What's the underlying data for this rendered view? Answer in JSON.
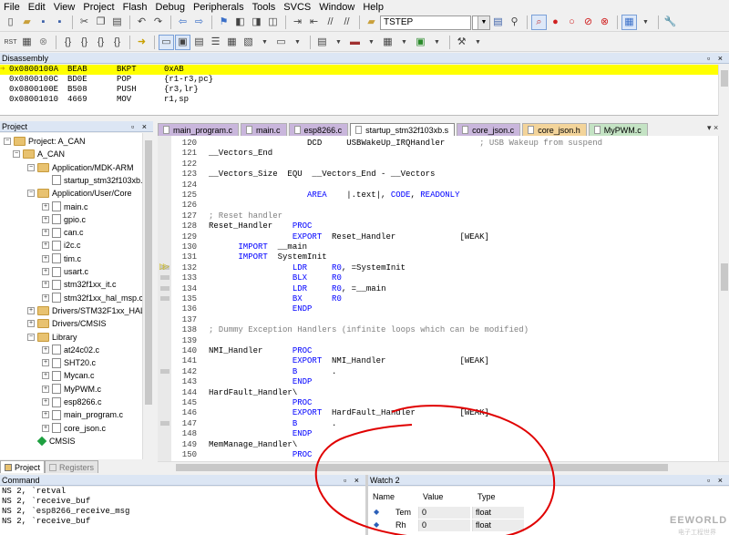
{
  "menu": [
    "File",
    "Edit",
    "View",
    "Project",
    "Flash",
    "Debug",
    "Peripherals",
    "Tools",
    "SVCS",
    "Window",
    "Help"
  ],
  "toolbar": {
    "find_text": "TSTEP"
  },
  "panels": {
    "disassembly": "Disassembly",
    "project": "Project",
    "command": "Command",
    "watch": "Watch 2"
  },
  "disassembly": [
    {
      "addr": "0x0800100A",
      "hex": "BEAB",
      "mnem": "BKPT",
      "ops": "0xAB"
    },
    {
      "addr": "0x0800100C",
      "hex": "BD0E",
      "mnem": "POP",
      "ops": "{r1-r3,pc}"
    },
    {
      "addr": "0x0800100E",
      "hex": "B508",
      "mnem": "PUSH",
      "ops": "{r3,lr}"
    },
    {
      "addr": "0x08001010",
      "hex": "4669",
      "mnem": "MOV",
      "ops": "r1,sp"
    }
  ],
  "tree": [
    {
      "label": "Project: A_CAN",
      "pm": "−"
    },
    {
      "label": "A_CAN",
      "pm": "−"
    },
    {
      "label": "Application/MDK-ARM",
      "pm": "−"
    },
    {
      "label": "startup_stm32f103xb.s",
      "pm": ""
    },
    {
      "label": "Application/User/Core",
      "pm": "−"
    },
    {
      "label": "main.c",
      "pm": "+"
    },
    {
      "label": "gpio.c",
      "pm": "+"
    },
    {
      "label": "can.c",
      "pm": "+"
    },
    {
      "label": "i2c.c",
      "pm": "+"
    },
    {
      "label": "tim.c",
      "pm": "+"
    },
    {
      "label": "usart.c",
      "pm": "+"
    },
    {
      "label": "stm32f1xx_it.c",
      "pm": "+"
    },
    {
      "label": "stm32f1xx_hal_msp.c",
      "pm": "+"
    },
    {
      "label": "Drivers/STM32F1xx_HAL_",
      "pm": "+"
    },
    {
      "label": "Drivers/CMSIS",
      "pm": "+"
    },
    {
      "label": "Library",
      "pm": "−"
    },
    {
      "label": "at24c02.c",
      "pm": "+"
    },
    {
      "label": "SHT20.c",
      "pm": "+"
    },
    {
      "label": "Mycan.c",
      "pm": "+"
    },
    {
      "label": "MyPWM.c",
      "pm": "+"
    },
    {
      "label": "esp8266.c",
      "pm": "+"
    },
    {
      "label": "main_program.c",
      "pm": "+"
    },
    {
      "label": "core_json.c",
      "pm": "+"
    },
    {
      "label": "CMSIS",
      "pm": ""
    }
  ],
  "project_tabs": [
    "Project",
    "Registers"
  ],
  "editor_tabs": [
    {
      "label": "main_program.c",
      "color": "#c9b6dc"
    },
    {
      "label": "main.c",
      "color": "#c9b6dc"
    },
    {
      "label": "esp8266.c",
      "color": "#c9b6dc"
    },
    {
      "label": "startup_stm32f103xb.s",
      "color": "#ffffff"
    },
    {
      "label": "core_json.c",
      "color": "#c9b6dc"
    },
    {
      "label": "core_json.h",
      "color": "#f3d49a"
    },
    {
      "label": "MyPWM.c",
      "color": "#c4e3c4"
    }
  ],
  "code": [
    {
      "n": "120",
      "parts": [
        [
          "                    ",
          ""
        ],
        [
          "DCD",
          ""
        ],
        [
          "     USBWakeUp_IRQHandler       ",
          ""
        ],
        [
          "; USB Wakeup from suspend",
          "cm"
        ]
      ]
    },
    {
      "n": "121",
      "parts": [
        [
          "__Vectors_End",
          ""
        ]
      ]
    },
    {
      "n": "122",
      "parts": []
    },
    {
      "n": "123",
      "parts": [
        [
          "__Vectors_Size  ",
          ""
        ],
        [
          "EQU",
          ""
        ],
        [
          "  __Vectors_End - __Vectors",
          ""
        ]
      ]
    },
    {
      "n": "124",
      "parts": []
    },
    {
      "n": "125",
      "parts": [
        [
          "                    ",
          ""
        ],
        [
          "AREA",
          "kw"
        ],
        [
          "    |.text|, ",
          ""
        ],
        [
          "CODE",
          "kw"
        ],
        [
          ", ",
          ""
        ],
        [
          "READONLY",
          "kw"
        ]
      ]
    },
    {
      "n": "126",
      "parts": []
    },
    {
      "n": "127",
      "parts": [
        [
          "; Reset handler",
          "cm"
        ]
      ]
    },
    {
      "n": "128",
      "parts": [
        [
          "Reset_Handler    ",
          ""
        ],
        [
          "PROC",
          "kw"
        ]
      ]
    },
    {
      "n": "129",
      "parts": [
        [
          "                 ",
          ""
        ],
        [
          "EXPORT",
          "kw"
        ],
        [
          "  Reset_Handler             [WEAK]",
          ""
        ]
      ]
    },
    {
      "n": "130",
      "parts": [
        [
          "      ",
          ""
        ],
        [
          "IMPORT",
          "kw"
        ],
        [
          "  __main",
          ""
        ]
      ]
    },
    {
      "n": "131",
      "parts": [
        [
          "      ",
          ""
        ],
        [
          "IMPORT",
          "kw"
        ],
        [
          "  SystemInit",
          ""
        ]
      ]
    },
    {
      "n": "132",
      "parts": [
        [
          "                 ",
          ""
        ],
        [
          "LDR",
          "kw"
        ],
        [
          "     ",
          ""
        ],
        [
          "R0",
          "kw"
        ],
        [
          ", =SystemInit",
          ""
        ]
      ]
    },
    {
      "n": "133",
      "parts": [
        [
          "                 ",
          ""
        ],
        [
          "BLX",
          "kw"
        ],
        [
          "     ",
          ""
        ],
        [
          "R0",
          "kw"
        ]
      ]
    },
    {
      "n": "134",
      "parts": [
        [
          "                 ",
          ""
        ],
        [
          "LDR",
          "kw"
        ],
        [
          "     ",
          ""
        ],
        [
          "R0",
          "kw"
        ],
        [
          ", =__main",
          ""
        ]
      ]
    },
    {
      "n": "135",
      "parts": [
        [
          "                 ",
          ""
        ],
        [
          "BX",
          "kw"
        ],
        [
          "      ",
          ""
        ],
        [
          "R0",
          "kw"
        ]
      ]
    },
    {
      "n": "136",
      "parts": [
        [
          "                 ",
          ""
        ],
        [
          "ENDP",
          "kw"
        ]
      ]
    },
    {
      "n": "137",
      "parts": []
    },
    {
      "n": "138",
      "parts": [
        [
          "; Dummy Exception Handlers (infinite loops which can be modified)",
          "cm"
        ]
      ]
    },
    {
      "n": "139",
      "parts": []
    },
    {
      "n": "140",
      "parts": [
        [
          "NMI_Handler      ",
          ""
        ],
        [
          "PROC",
          "kw"
        ]
      ]
    },
    {
      "n": "141",
      "parts": [
        [
          "                 ",
          ""
        ],
        [
          "EXPORT",
          "kw"
        ],
        [
          "  NMI_Handler               [WEAK]",
          ""
        ]
      ]
    },
    {
      "n": "142",
      "parts": [
        [
          "                 ",
          ""
        ],
        [
          "B",
          "kw"
        ],
        [
          "       .",
          ""
        ]
      ]
    },
    {
      "n": "143",
      "parts": [
        [
          "                 ",
          ""
        ],
        [
          "ENDP",
          "kw"
        ]
      ]
    },
    {
      "n": "144",
      "parts": [
        [
          "HardFault_Handler\\",
          ""
        ]
      ]
    },
    {
      "n": "145",
      "parts": [
        [
          "                 ",
          ""
        ],
        [
          "PROC",
          "kw"
        ]
      ]
    },
    {
      "n": "146",
      "parts": [
        [
          "                 ",
          ""
        ],
        [
          "EXPORT",
          "kw"
        ],
        [
          "  HardFault_Handler         [WEAK]",
          ""
        ]
      ]
    },
    {
      "n": "147",
      "parts": [
        [
          "                 ",
          ""
        ],
        [
          "B",
          "kw"
        ],
        [
          "       .",
          ""
        ]
      ]
    },
    {
      "n": "148",
      "parts": [
        [
          "                 ",
          ""
        ],
        [
          "ENDP",
          "kw"
        ]
      ]
    },
    {
      "n": "149",
      "parts": [
        [
          "MemManage_Handler\\",
          ""
        ]
      ]
    },
    {
      "n": "150",
      "parts": [
        [
          "                 ",
          ""
        ],
        [
          "PROC",
          "kw"
        ]
      ]
    }
  ],
  "command_lines": [
    "NS 2, `retval",
    "NS 2, `receive_buf",
    "NS 2, `esp8266_receive_msg",
    "NS 2, `receive_buf"
  ],
  "watch": {
    "headers": [
      "Name",
      "Value",
      "Type"
    ],
    "rows": [
      {
        "name": "Tem",
        "value": "0",
        "type": "float"
      },
      {
        "name": "Rh",
        "value": "0",
        "type": "float"
      }
    ]
  },
  "watermark": {
    "brand": "EEWORLD",
    "sub": "电子工程世界"
  },
  "colors": {
    "pc_highlight": "#ffff00",
    "keyword": "#0000ff",
    "comment": "#808080",
    "annotation": "#e00000"
  }
}
